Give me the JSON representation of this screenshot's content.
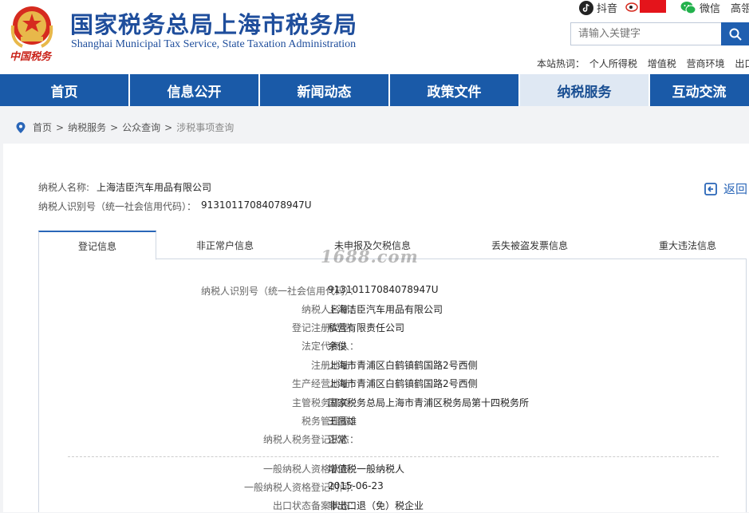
{
  "header": {
    "title_cn": "国家税务总局上海市税务局",
    "title_en": "Shanghai Municipal Tax Service, State Taxation Administration",
    "emblem_text": "中国税务",
    "social": {
      "douyin": "抖音",
      "weixin": "微信",
      "more": "高瓴"
    },
    "search": {
      "placeholder": "请输入关键字"
    },
    "hot": {
      "label": "本站热词：",
      "words": [
        "个人所得税",
        "增值税",
        "营商环境",
        "出口退"
      ]
    }
  },
  "nav": {
    "items": [
      "首页",
      "信息公开",
      "新闻动态",
      "政策文件",
      "纳税服务",
      "互动交流"
    ],
    "active_index": 4
  },
  "breadcrumb": {
    "items": [
      "首页",
      "纳税服务",
      "公众查询"
    ],
    "current": "涉税事项查询",
    "separator": ">"
  },
  "taxpayer": {
    "name_label": "纳税人名称:",
    "name": "上海洁臣汽车用品有限公司",
    "id_label": "纳税人识别号（统一社会信用代码）：",
    "id": "91310117084078947U"
  },
  "back_label": "返回",
  "tabs": [
    "登记信息",
    "非正常户信息",
    "未申报及欠税信息",
    "丢失被盗发票信息",
    "重大违法信息"
  ],
  "active_tab": 0,
  "watermark": "1688.com",
  "registration": [
    {
      "label": "纳税人识别号（统一社会信用代码）：",
      "value": "91310117084078947U"
    },
    {
      "label": "纳税人名称：",
      "value": "上海洁臣汽车用品有限公司"
    },
    {
      "label": "登记注册类型：",
      "value": "私营有限责任公司"
    },
    {
      "label": "法定代表人：",
      "value": "余俊"
    },
    {
      "label": "注册地址：",
      "value": "上海市青浦区白鹤镇鹤国路2号西侧"
    },
    {
      "label": "生产经营地址：",
      "value": "上海市青浦区白鹤镇鹤国路2号西侧"
    },
    {
      "label": "主管税务机关：",
      "value": "国家税务总局上海市青浦区税务局第十四税务所"
    },
    {
      "label": "税务管理员：",
      "value": "王昌雄"
    },
    {
      "label": "纳税人税务登记状态：",
      "value": "正常"
    }
  ],
  "qualification": [
    {
      "label": "一般纳税人资格状态：",
      "value": "增值税一般纳税人"
    },
    {
      "label": "一般纳税人资格登记时间：",
      "value": "2015-06-23"
    },
    {
      "label": "出口状态备案状态：",
      "value": "非出口退（免）税企业"
    }
  ],
  "colors": {
    "brand_blue": "#1f4e9c",
    "nav_blue": "#1a5aa8",
    "nav_active_bg": "#dfe8f3",
    "link_blue": "#2a66b8"
  }
}
